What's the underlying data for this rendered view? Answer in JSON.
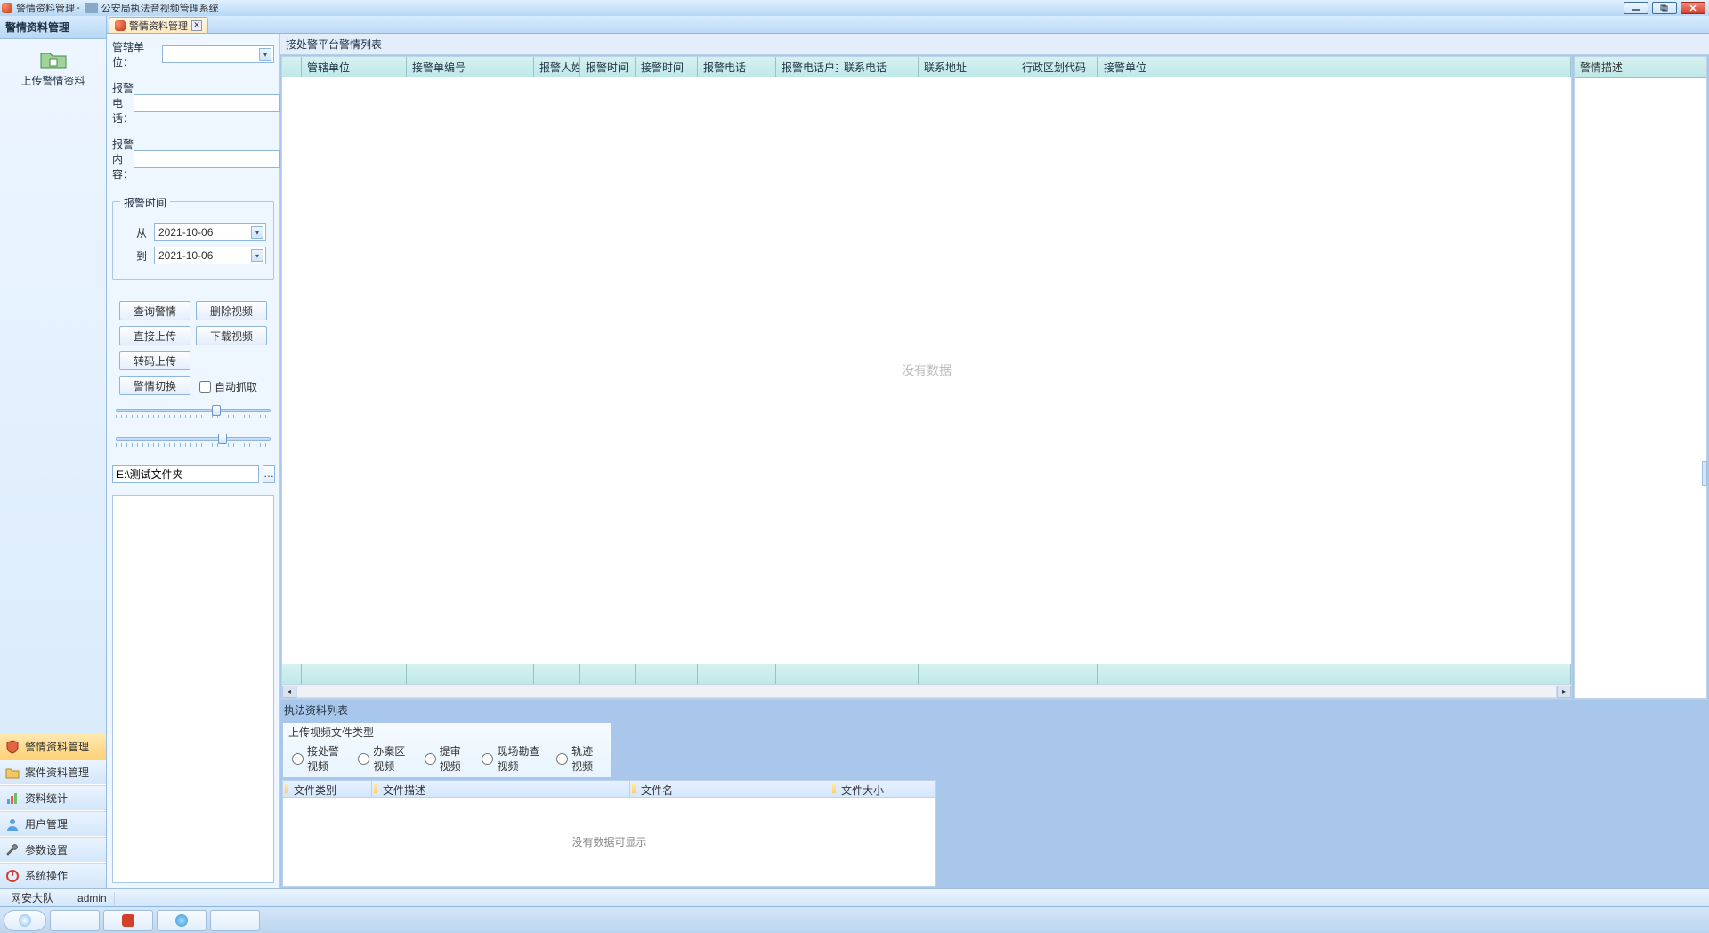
{
  "window": {
    "title_left": "警情资料管理",
    "title_right": "公安局执法音视频管理系统"
  },
  "sidebar": {
    "header": "警情资料管理",
    "upload_label": "上传警情资料",
    "nav": [
      {
        "label": "警情资料管理",
        "icon": "shield"
      },
      {
        "label": "案件资料管理",
        "icon": "folder"
      },
      {
        "label": "资料统计",
        "icon": "chart"
      },
      {
        "label": "用户管理",
        "icon": "user"
      },
      {
        "label": "参数设置",
        "icon": "wrench"
      },
      {
        "label": "系统操作",
        "icon": "power"
      }
    ]
  },
  "tab": {
    "title": "警情资料管理"
  },
  "form": {
    "unit_label": "管辖单位：",
    "phone_label": "报警电话：",
    "content_label": "报警内容：",
    "time_group": "报警时间",
    "from_label": "从",
    "to_label": "到",
    "date_from": "2021-10-06",
    "date_to": "2021-10-06",
    "buttons": {
      "query": "查询警情",
      "del_video": "删除视频",
      "direct_upload": "直接上传",
      "download_video": "下载视频",
      "transcode_upload": "转码上传",
      "switch": "警情切换"
    },
    "auto_capture": "自动抓取",
    "path": "E:\\测试文件夹"
  },
  "main_list": {
    "title": "接处警平台警情列表",
    "columns": [
      "管辖单位",
      "接警单编号",
      "报警人姓名",
      "报警时间",
      "接警时间",
      "报警电话",
      "报警电话户主",
      "联系电话",
      "联系地址",
      "行政区划代码",
      "接警单位"
    ],
    "empty": "没有数据",
    "desc_header": "警情描述"
  },
  "bottom_list": {
    "title": "执法资料列表",
    "upload_group": "上传视频文件类型",
    "radios": [
      "接处警视频",
      "办案区视频",
      "提审视频",
      "现场勘查视频",
      "轨迹视频"
    ],
    "columns": [
      "文件类别",
      "文件描述",
      "文件名",
      "文件大小"
    ],
    "empty": "没有数据可显示"
  },
  "status": {
    "org": "网安大队",
    "user": "admin"
  }
}
